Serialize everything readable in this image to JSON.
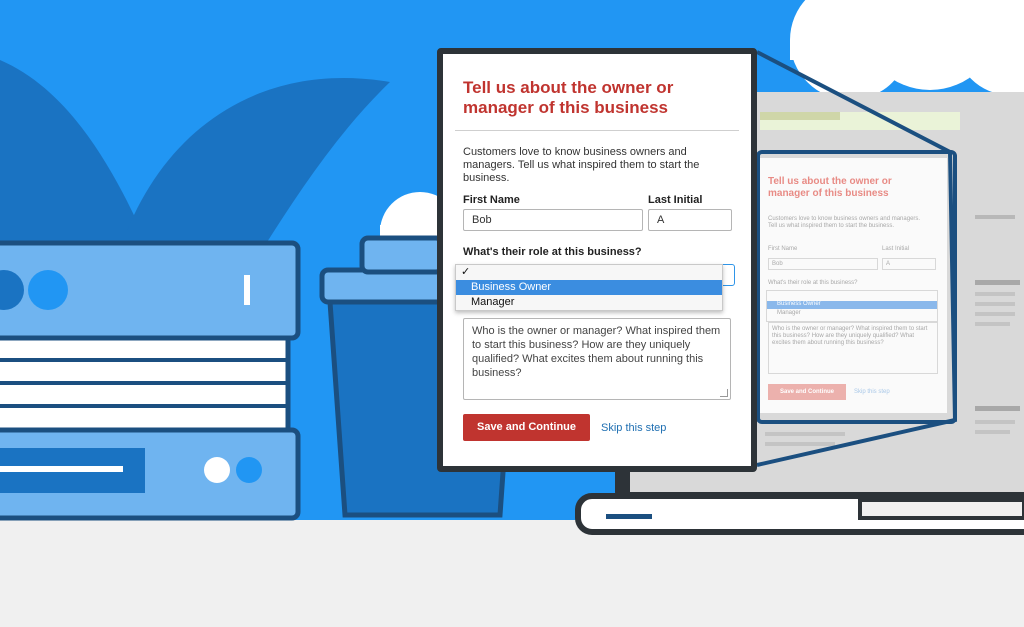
{
  "modal": {
    "title": "Tell us about the owner or manager of this business",
    "intro": "Customers love to know business owners and managers. Tell us what inspired them to start the business.",
    "first_name_label": "First Name",
    "first_name_value": "Bob",
    "last_initial_label": "Last Initial",
    "last_initial_value": "A",
    "role_label": "What's their role at this business?",
    "role_options": [
      {
        "label": "",
        "checked": true
      },
      {
        "label": "Business Owner",
        "highlighted": true
      },
      {
        "label": "Manager"
      }
    ],
    "textarea_placeholder": "Who is the owner or manager? What inspired them to start this business? How are they uniquely qualified? What excites them about running this business?",
    "save_button": "Save and Continue",
    "skip_link": "Skip this step"
  },
  "ghost": {
    "title": "Tell us about the owner or manager of this business",
    "intro": "Customers love to know business owners and managers. Tell us what inspired them to start the business.",
    "first_name_label": "First Name",
    "last_initial_label": "Last Initial",
    "first_name_value": "Bob",
    "last_initial_value": "A",
    "role_label": "What's their role at this business?",
    "option_owner": "Business Owner",
    "option_manager": "Manager",
    "textarea_placeholder": "Who is the owner or manager? What inspired them to start this business? How are they uniquely qualified? What excites them about running this business?",
    "save_button": "Save and Continue",
    "skip_link": "Skip this step"
  },
  "colors": {
    "background_blue": "#2196f3",
    "accent_red": "#c0342f",
    "link_blue": "#1f6fb2",
    "dark_outline": "#2d3338"
  }
}
